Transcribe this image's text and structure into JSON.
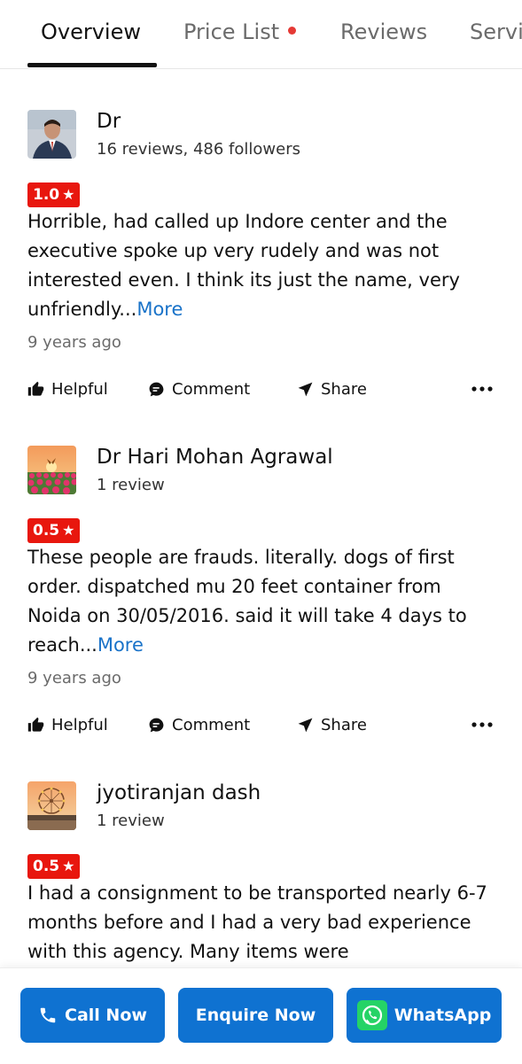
{
  "tabs": [
    {
      "label": "Overview",
      "active": true
    },
    {
      "label": "Price List",
      "has_dot": true
    },
    {
      "label": "Reviews"
    },
    {
      "label": "Servi"
    }
  ],
  "reviews": [
    {
      "name": "Dr",
      "meta": "16 reviews, 486 followers",
      "rating": "1.0",
      "text": "Horrible, had called up Indore center and the executive spoke up very rudely and was not interested even. I think its just the name, very unfriendly...",
      "more": "More",
      "time": "9 years ago"
    },
    {
      "name": "Dr Hari Mohan Agrawal",
      "meta": "1 review",
      "rating": "0.5",
      "text": "These people are frauds. literally. dogs of first order. dispatched mu 20 feet container from Noida on 30/05/2016. said it will take 4 days to reach...",
      "more": "More",
      "time": "9 years ago"
    },
    {
      "name": "jyotiranjan dash",
      "meta": "1 review",
      "rating": "0.5",
      "text": "I had a consignment to be transported nearly 6-7 months before and I had a very bad experience with this agency. Many items were"
    }
  ],
  "actions": {
    "helpful": "Helpful",
    "comment": "Comment",
    "share": "Share"
  },
  "bottom_bar": {
    "call": "Call Now",
    "enquire": "Enquire Now",
    "whatsapp": "WhatsApp"
  },
  "colors": {
    "rating_badge": "#e8170e",
    "primary_button": "#0f72d1",
    "link": "#1a73c9",
    "whatsapp_green": "#25d366"
  }
}
